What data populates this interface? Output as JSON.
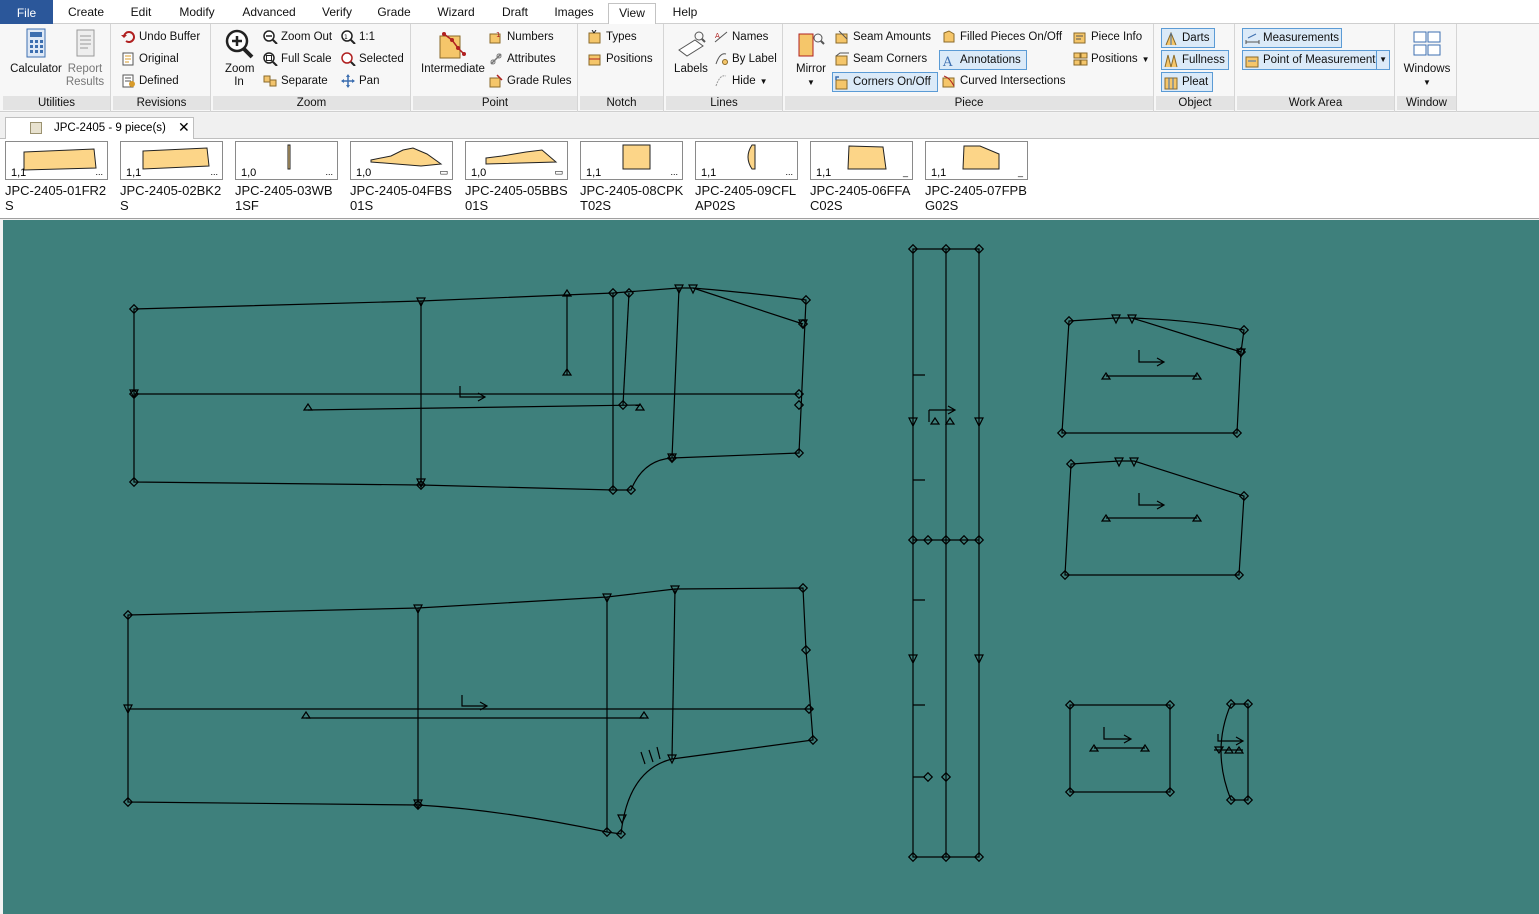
{
  "menu": {
    "tabs": [
      "File",
      "Create",
      "Edit",
      "Modify",
      "Advanced",
      "Verify",
      "Grade",
      "Wizard",
      "Draft",
      "Images",
      "View",
      "Help"
    ],
    "active": "View"
  },
  "ribbon": {
    "utilities": {
      "label": "Utilities",
      "calculator": "Calculator",
      "report_results": "Report Results"
    },
    "revisions": {
      "label": "Revisions",
      "undo_buffer": "Undo Buffer",
      "original": "Original",
      "defined": "Defined"
    },
    "zoom": {
      "label": "Zoom",
      "zoom_in": "Zoom In",
      "zoom_out": "Zoom Out",
      "full_scale": "Full Scale",
      "separate": "Separate",
      "one_to_one": "1:1",
      "selected": "Selected",
      "pan": "Pan"
    },
    "point": {
      "label": "Point",
      "intermediate": "Intermediate",
      "numbers": "Numbers",
      "attributes": "Attributes",
      "grade_rules": "Grade Rules"
    },
    "notch": {
      "label": "Notch",
      "types": "Types",
      "positions": "Positions"
    },
    "lines": {
      "label": "Lines",
      "labels": "Labels",
      "names": "Names",
      "by_label": "By Label",
      "hide": "Hide"
    },
    "piece": {
      "label": "Piece",
      "mirror": "Mirror",
      "seam_amounts": "Seam Amounts",
      "seam_corners": "Seam Corners",
      "corners_on_off": "Corners On/Off",
      "filled_pieces": "Filled Pieces On/Off",
      "annotations": "Annotations",
      "curved_intersections": "Curved Intersections",
      "piece_info": "Piece Info",
      "positions": "Positions"
    },
    "object": {
      "label": "Object",
      "darts": "Darts",
      "fullness": "Fullness",
      "pleat": "Pleat"
    },
    "work_area": {
      "label": "Work Area",
      "measurements": "Measurements",
      "point_of_measurement": "Point of Measurement"
    },
    "window": {
      "label": "Window",
      "windows": "Windows"
    }
  },
  "document_tab": {
    "title": "JPC-2405  -  9 piece(s)",
    "close": "✕"
  },
  "pieces": [
    {
      "name": "JPC-2405-01FR2S",
      "count": "1,1",
      "flag": "..."
    },
    {
      "name": "JPC-2405-02BK2S",
      "count": "1,1",
      "flag": "..."
    },
    {
      "name": "JPC-2405-03WB1SF",
      "count": "1,0",
      "flag": "..."
    },
    {
      "name": "JPC-2405-04FBS01S",
      "count": "1,0",
      "flag": "▭"
    },
    {
      "name": "JPC-2405-05BBS01S",
      "count": "1,0",
      "flag": "▭"
    },
    {
      "name": "JPC-2405-08CPKT02S",
      "count": "1,1",
      "flag": "..."
    },
    {
      "name": "JPC-2405-09CFLAP02S",
      "count": "1,1",
      "flag": "..."
    },
    {
      "name": "JPC-2405-06FFAC02S",
      "count": "1,1",
      "flag": "_"
    },
    {
      "name": "JPC-2405-07FPBG02S",
      "count": "1,1",
      "flag": "_"
    }
  ],
  "colors": {
    "workarea_bg": "#3e807c",
    "piece_fill": "#fcd588",
    "selected_bg": "#dbeaf8",
    "file_tab": "#2b579a"
  }
}
